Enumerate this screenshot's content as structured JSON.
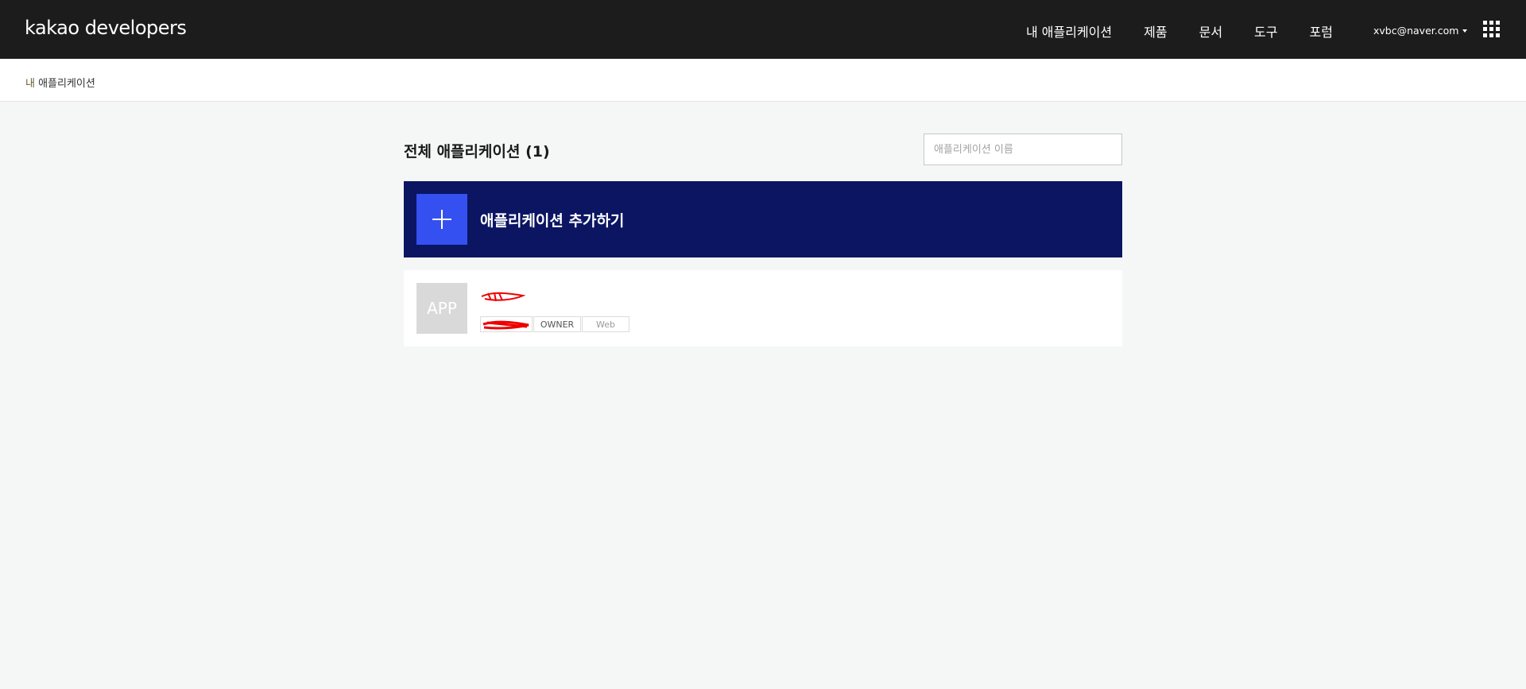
{
  "header": {
    "logo_main": "kakao",
    "logo_sub": " developers",
    "nav": [
      "내 애플리케이션",
      "제품",
      "문서",
      "도구",
      "포럼"
    ],
    "account_email": "xvbc@naver.com",
    "apps_menu_icon": "grid-icon"
  },
  "breadcrumb": {
    "first": "내 ",
    "rest": "애플리케이션"
  },
  "main": {
    "title": "전체 애플리케이션 (1)",
    "search_placeholder": "애플리케이션 이름",
    "add_app_label": "애플리케이션 추가하기",
    "apps": [
      {
        "icon_text": "APP",
        "name": "",
        "id_tag": "",
        "role_tag": "OWNER",
        "platform_tag": "Web"
      }
    ]
  },
  "colors": {
    "topbar": "#1c1c1d",
    "add_banner": "#0b1562",
    "add_plus_box": "#3550f0",
    "redaction": "#ee0000"
  }
}
